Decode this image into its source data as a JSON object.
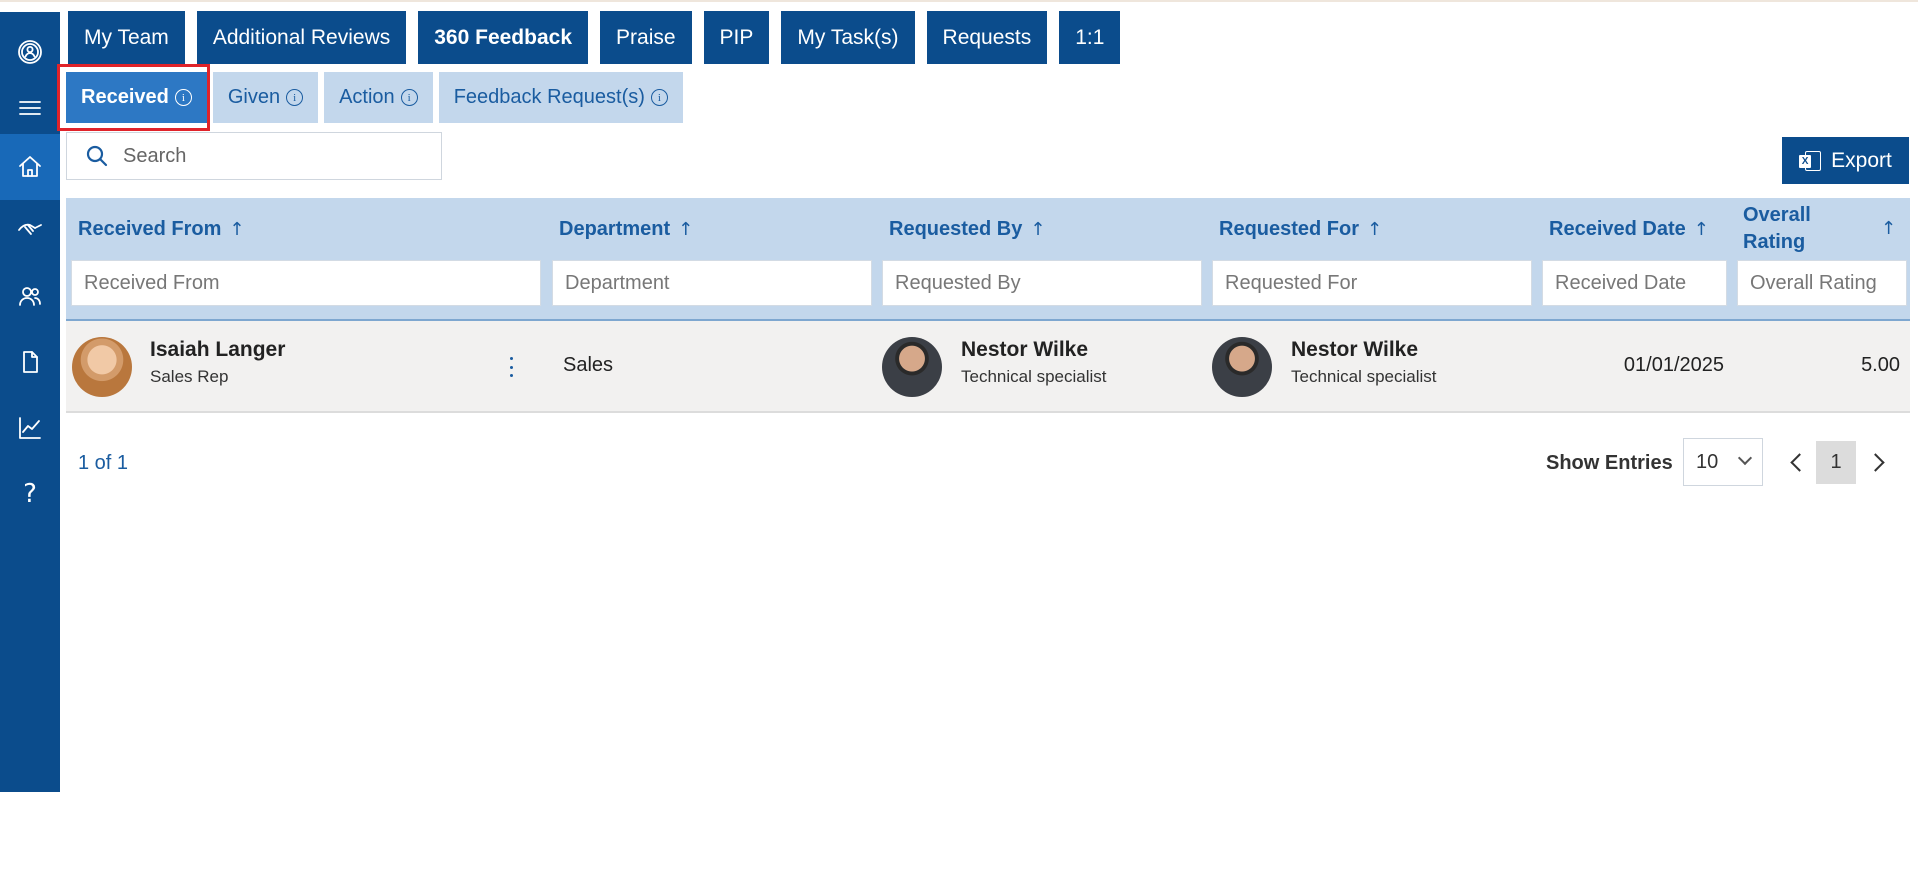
{
  "top_tabs": [
    "My Team",
    "Additional Reviews",
    "360 Feedback",
    "Praise",
    "PIP",
    "My Task(s)",
    "Requests",
    "1:1"
  ],
  "sub_tabs": [
    "Received",
    "Given",
    "Action",
    "Feedback Request(s)"
  ],
  "active_sub_tab": "Received",
  "sidebar_icons": [
    "profile-icon",
    "menu-icon",
    "home-icon",
    "handshake-icon",
    "team-icon",
    "document-icon",
    "chart-icon",
    "help-icon"
  ],
  "sidebar": {
    "help_glyph": "?"
  },
  "search": {
    "placeholder": "Search"
  },
  "export_label": "Export",
  "table": {
    "columns": [
      "Received From",
      "Department",
      "Requested By",
      "Requested For",
      "Received Date",
      "Overall Rating"
    ],
    "column_short": {
      "overall_1": "Overall",
      "overall_2": "Rating"
    },
    "filter_placeholders": [
      "Received From",
      "Department",
      "Requested By",
      "Requested For",
      "Received Date",
      "Overall Rating"
    ],
    "rows": [
      {
        "received_from": {
          "name": "Isaiah Langer",
          "title": "Sales Rep"
        },
        "department": "Sales",
        "requested_by": {
          "name": "Nestor Wilke",
          "title": "Technical specialist"
        },
        "requested_for": {
          "name": "Nestor Wilke",
          "title": "Technical specialist"
        },
        "received_date": "01/01/2025",
        "overall_rating": "5.00"
      }
    ]
  },
  "pagination": {
    "summary": "1 of 1",
    "show_entries_label": "Show Entries",
    "page_size": "10",
    "current_page": "1"
  },
  "colors": {
    "primary": "#0b4c8c",
    "header_bg": "#c3d7ec",
    "accent": "#2d78c4",
    "highlight": "#e0232a"
  }
}
